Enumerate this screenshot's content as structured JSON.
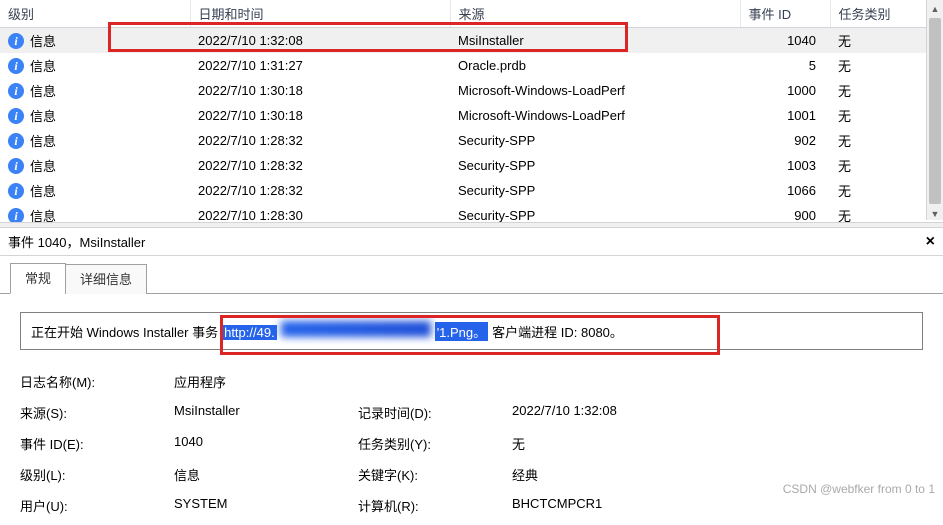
{
  "columns": {
    "level": "级别",
    "time": "日期和时间",
    "source": "来源",
    "id": "事件 ID",
    "task": "任务类别"
  },
  "level_info": "信息",
  "rows": [
    {
      "time": "2022/7/10 1:32:08",
      "src": "MsiInstaller",
      "id": "1040",
      "task": "无"
    },
    {
      "time": "2022/7/10 1:31:27",
      "src": "Oracle.prdb",
      "id": "5",
      "task": "无"
    },
    {
      "time": "2022/7/10 1:30:18",
      "src": "Microsoft-Windows-LoadPerf",
      "id": "1000",
      "task": "无"
    },
    {
      "time": "2022/7/10 1:30:18",
      "src": "Microsoft-Windows-LoadPerf",
      "id": "1001",
      "task": "无"
    },
    {
      "time": "2022/7/10 1:28:32",
      "src": "Security-SPP",
      "id": "902",
      "task": "无"
    },
    {
      "time": "2022/7/10 1:28:32",
      "src": "Security-SPP",
      "id": "1003",
      "task": "无"
    },
    {
      "time": "2022/7/10 1:28:32",
      "src": "Security-SPP",
      "id": "1066",
      "task": "无"
    },
    {
      "time": "2022/7/10 1:28:30",
      "src": "Security-SPP",
      "id": "900",
      "task": "无"
    }
  ],
  "details": {
    "title": "事件 1040，MsiInstaller",
    "tabs": {
      "general": "常规",
      "details": "详细信息"
    },
    "msg_pre": "正在开始 Windows Installer 事务 ",
    "msg_url": "http://49.",
    "msg_url2": "'1.Png。",
    "msg_post": " 客户端进程 ID: 8080。",
    "labels": {
      "log": "日志名称(M):",
      "app": "应用程序",
      "src": "来源(S):",
      "srcv": "MsiInstaller",
      "logtime": "记录时间(D):",
      "logtimev": "2022/7/10 1:32:08",
      "eid": "事件 ID(E):",
      "eidv": "1040",
      "task": "任务类别(Y):",
      "taskv": "无",
      "lvl": "级别(L):",
      "lvlv": "信息",
      "kw": "关键字(K):",
      "kwv": "经典",
      "usr": "用户(U):",
      "usrv": "SYSTEM",
      "comp": "计算机(R):",
      "compv": "BHCTCMPCR1"
    }
  },
  "watermark": "CSDN @webfker from 0 to 1"
}
